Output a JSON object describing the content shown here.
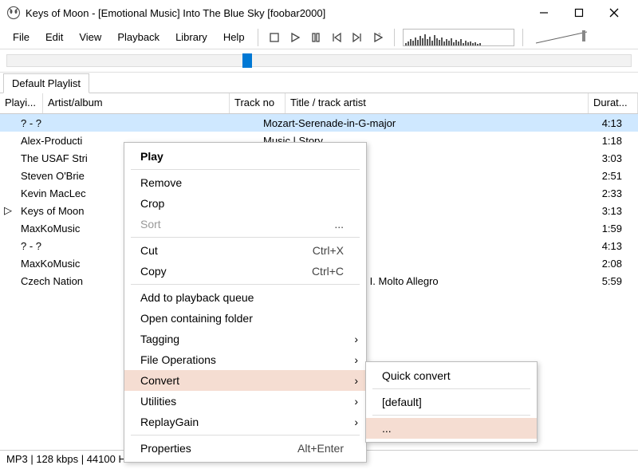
{
  "window": {
    "title": "Keys of Moon - [Emotional Music] Into The Blue Sky  [foobar2000]"
  },
  "menu": {
    "file": "File",
    "edit": "Edit",
    "view": "View",
    "playback": "Playback",
    "library": "Library",
    "help": "Help"
  },
  "tabs": {
    "default": "Default Playlist"
  },
  "columns": {
    "playing": "Playi...",
    "artist": "Artist/album",
    "trackno": "Track no",
    "title": "Title / track artist",
    "duration": "Durat..."
  },
  "tracks": [
    {
      "playing": "",
      "artist": "? - ?",
      "title": "Mozart-Serenade-in-G-major",
      "dur": "4:13",
      "selected": true
    },
    {
      "playing": "",
      "artist": "Alex-Producti",
      "title": "Music | Story",
      "dur": "1:18"
    },
    {
      "playing": "",
      "artist": "The USAF Stri",
      "title": "",
      "dur": "3:03"
    },
    {
      "playing": "",
      "artist": "Steven O'Brie",
      "title": "1",
      "dur": "2:51"
    },
    {
      "playing": "",
      "artist": "Kevin MacLec",
      "title": "ntain King",
      "dur": "2:33"
    },
    {
      "playing": "▷",
      "artist": "Keys of Moon",
      "title": "y",
      "dur": "3:13"
    },
    {
      "playing": "",
      "artist": "MaxKoMusic",
      "title": "",
      "dur": "1:59"
    },
    {
      "playing": "",
      "artist": "? - ?",
      "title": "e-in-G-major",
      "dur": "4:13"
    },
    {
      "playing": "",
      "artist": "MaxKoMusic",
      "title": "",
      "dur": "2:08"
    },
    {
      "playing": "",
      "artist": "Czech Nation",
      "title": "40 in G Minor, K. 550 - I. Molto Allegro",
      "dur": "5:59"
    }
  ],
  "context": {
    "play": "Play",
    "remove": "Remove",
    "crop": "Crop",
    "sort": "Sort",
    "sort_ellipsis": "...",
    "cut": "Cut",
    "cut_sc": "Ctrl+X",
    "copy": "Copy",
    "copy_sc": "Ctrl+C",
    "add_queue": "Add to playback queue",
    "open_folder": "Open containing folder",
    "tagging": "Tagging",
    "file_ops": "File Operations",
    "convert": "Convert",
    "utilities": "Utilities",
    "replaygain": "ReplayGain",
    "properties": "Properties",
    "properties_sc": "Alt+Enter"
  },
  "submenu": {
    "quick": "Quick convert",
    "default": "[default]",
    "ellipsis": "..."
  },
  "status": "MP3 | 128 kbps | 44100 H"
}
